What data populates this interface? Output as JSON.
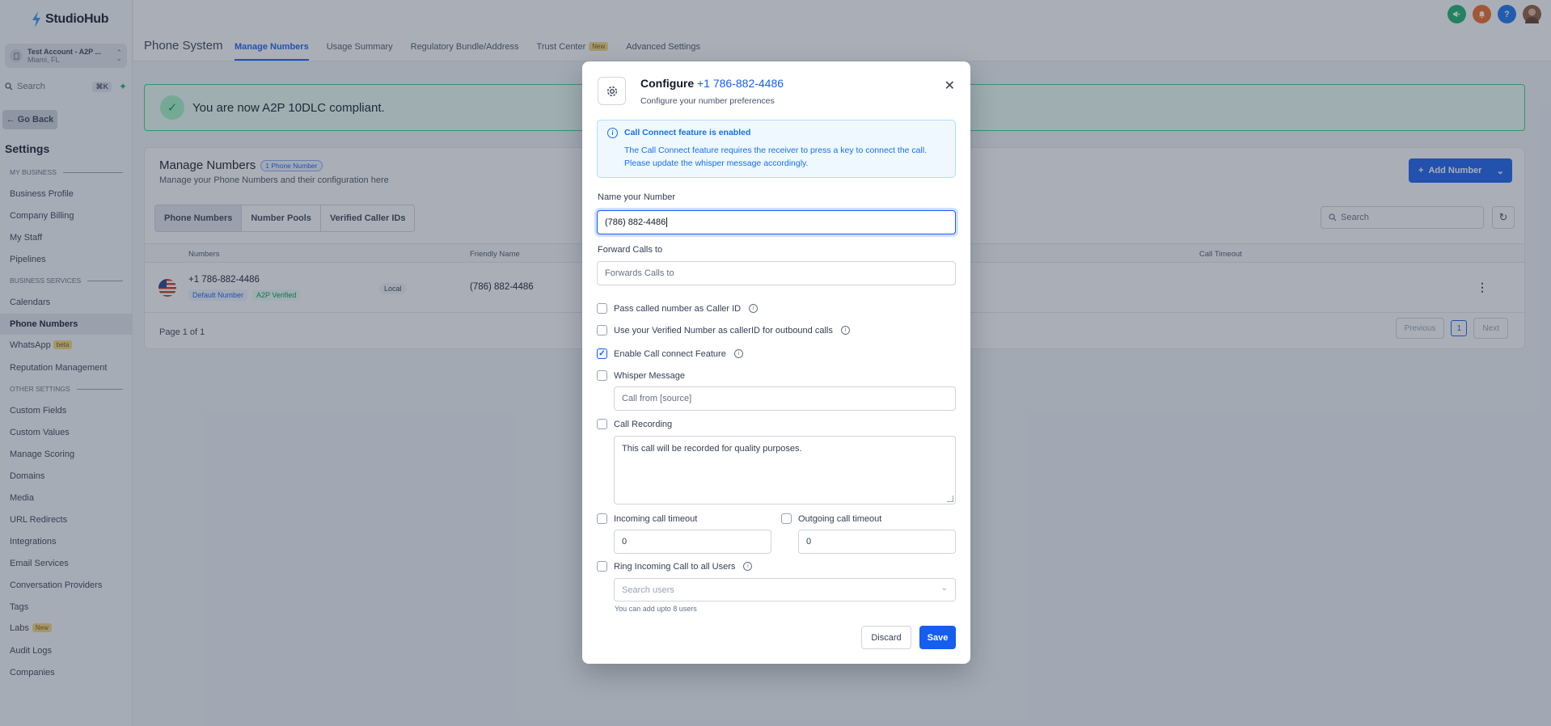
{
  "sidebar": {
    "logo": "StudioHub",
    "account": {
      "name": "Test Account - A2P ...",
      "location": "Miami, FL"
    },
    "search": {
      "label": "Search",
      "shortcut": "⌘K"
    },
    "go_back": "Go Back",
    "settings_title": "Settings",
    "sections": {
      "my_business": "MY BUSINESS",
      "business_services": "BUSINESS SERVICES",
      "other_settings": "OTHER SETTINGS"
    },
    "items": {
      "business_profile": "Business Profile",
      "company_billing": "Company Billing",
      "my_staff": "My Staff",
      "pipelines": "Pipelines",
      "calendars": "Calendars",
      "phone_numbers": "Phone Numbers",
      "whatsapp": "WhatsApp",
      "whatsapp_badge": "beta",
      "reputation": "Reputation Management",
      "custom_fields": "Custom Fields",
      "custom_values": "Custom Values",
      "manage_scoring": "Manage Scoring",
      "domains": "Domains",
      "media": "Media",
      "url_redirects": "URL Redirects",
      "integrations": "Integrations",
      "email_services": "Email Services",
      "conversation_providers": "Conversation Providers",
      "tags": "Tags",
      "labs": "Labs",
      "labs_badge": "New",
      "audit_logs": "Audit Logs",
      "companies": "Companies"
    }
  },
  "header": {
    "title": "Phone System",
    "tabs": {
      "manage_numbers": "Manage Numbers",
      "usage_summary": "Usage Summary",
      "regulatory": "Regulatory Bundle/Address",
      "trust_center": "Trust Center",
      "trust_badge": "New",
      "advanced": "Advanced Settings"
    }
  },
  "alert": {
    "text": "You are now A2P 10DLC compliant."
  },
  "manage": {
    "title": "Manage Numbers",
    "count_badge": "1 Phone Number",
    "subtitle": "Manage your Phone Numbers and their configuration here",
    "add_button": "Add Number",
    "segments": {
      "phone_numbers": "Phone Numbers",
      "number_pools": "Number Pools",
      "verified_caller_ids": "Verified Caller IDs"
    },
    "search_placeholder": "Search",
    "columns": {
      "numbers": "Numbers",
      "friendly_name": "Friendly Name",
      "call_timeout": "Call Timeout"
    },
    "row": {
      "number": "+1 786-882-4486",
      "tag_default": "Default Number",
      "tag_a2p": "A2P Verified",
      "type": "Local",
      "friendly_name": "(786) 882-4486"
    },
    "page_info": "Page 1 of 1",
    "pager": {
      "previous": "Previous",
      "current": "1",
      "next": "Next"
    }
  },
  "modal": {
    "title_prefix": "Configure",
    "title_number": "+1 786-882-4486",
    "subtitle": "Configure your number preferences",
    "info_title": "Call Connect feature is enabled",
    "info_body": "The Call Connect feature requires the receiver to press a key to connect the call. Please update the whisper message accordingly.",
    "name_label": "Name your Number",
    "name_value": "(786) 882-4486",
    "forward_label": "Forward Calls to",
    "forward_placeholder": "Forwards Calls to",
    "pass_caller_id": "Pass called number as Caller ID",
    "use_verified": "Use your Verified Number as callerID for outbound calls",
    "enable_call_connect": "Enable Call connect Feature",
    "whisper_label": "Whisper Message",
    "whisper_placeholder": "Call from [source]",
    "recording_label": "Call Recording",
    "recording_value": "This call will be recorded for quality purposes.",
    "incoming_timeout_label": "Incoming call timeout",
    "incoming_timeout_value": "0",
    "outgoing_timeout_label": "Outgoing call timeout",
    "outgoing_timeout_value": "0",
    "ring_all_label": "Ring Incoming Call to all Users",
    "users_placeholder": "Search users",
    "users_helper": "You can add upto 8 users",
    "discard": "Discard",
    "save": "Save"
  },
  "checkbox_states": {
    "pass_caller_id": false,
    "use_verified": false,
    "enable_call_connect": true,
    "whisper": false,
    "recording": false,
    "incoming_timeout": false,
    "outgoing_timeout": false,
    "ring_all": false
  },
  "colors": {
    "primary": "#155eef",
    "success": "#039855",
    "info_bg": "#eff8ff"
  }
}
